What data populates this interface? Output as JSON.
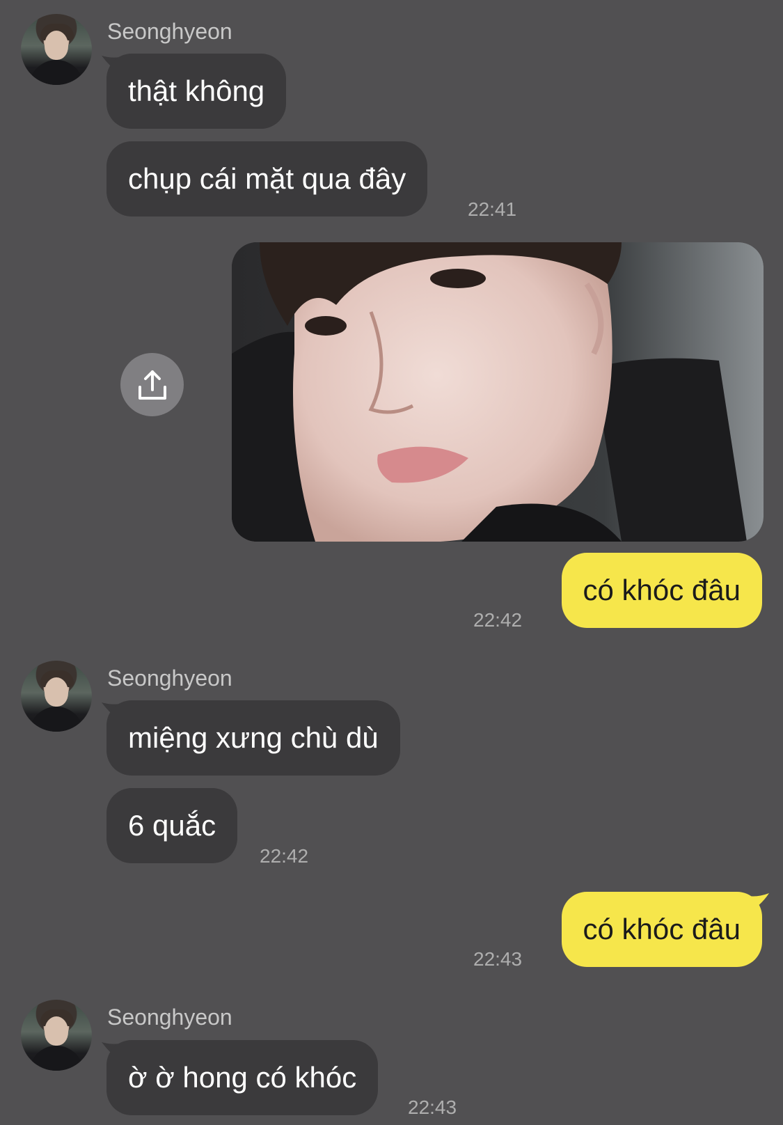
{
  "contact": {
    "name": "Seonghyeon"
  },
  "messages": {
    "m1": "thật không",
    "m2": "chụp cái mặt qua đây",
    "m3": "có khóc đâu",
    "m4": "miệng xưng chù dù",
    "m5": "6 quắc",
    "m6": "có khóc đâu",
    "m7": "ờ ờ hong có khóc"
  },
  "times": {
    "t1": "22:41",
    "t2": "22:42",
    "t3": "22:42",
    "t4": "22:43",
    "t5": "22:43"
  },
  "icons": {
    "share": "share-upload-icon"
  },
  "colors": {
    "background": "#515052",
    "incoming_bubble": "#3b3a3c",
    "outgoing_bubble": "#f6e64b"
  }
}
